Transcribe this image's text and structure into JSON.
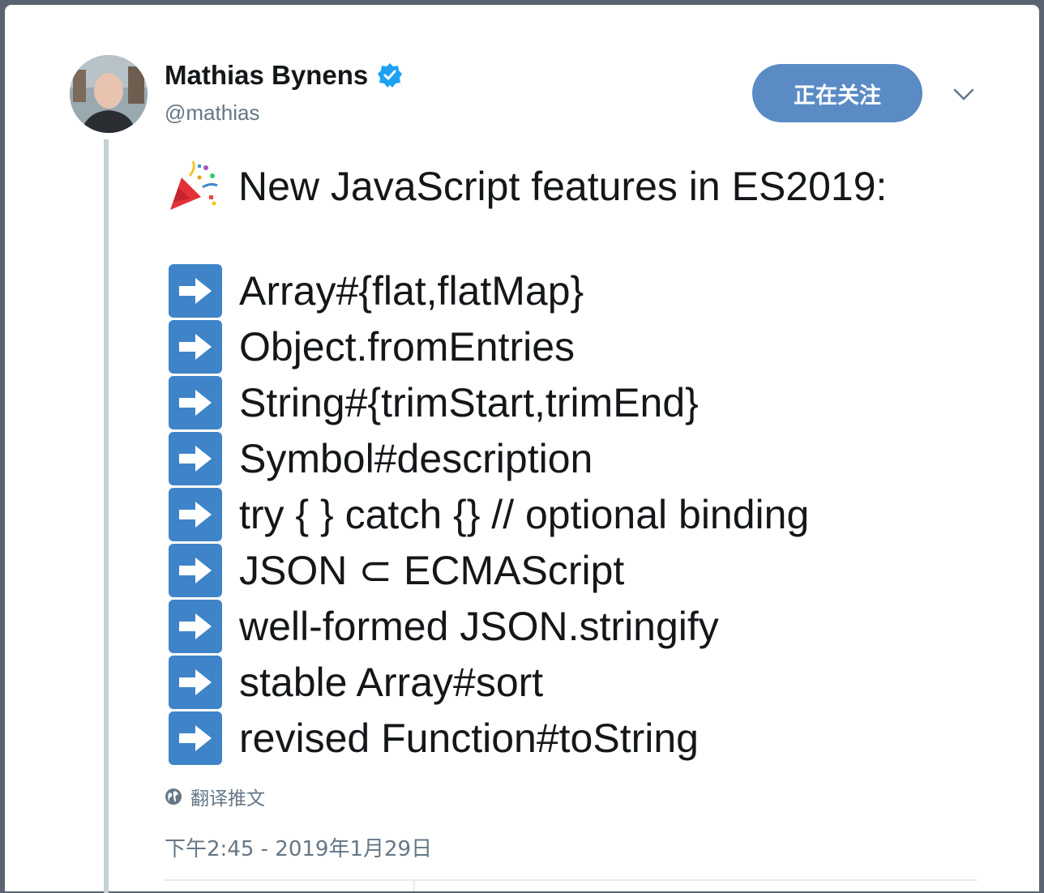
{
  "author": {
    "display_name": "Mathias Bynens",
    "handle": "@mathias",
    "verified": true
  },
  "follow_button": {
    "label": "正在关注"
  },
  "tweet": {
    "headline_emoji": "party-popper-icon",
    "headline": "New JavaScript features in ES2019:",
    "bullet_icon": "right-arrow-icon",
    "features": [
      "Array#{flat,flatMap}",
      "Object.fromEntries",
      "String#{trimStart,trimEnd}",
      "Symbol#description",
      "try { } catch {} // optional binding",
      "JSON ⊂ ECMAScript",
      "well-formed JSON.stringify",
      "stable Array#sort",
      "revised Function#toString"
    ]
  },
  "translate_label": "翻译推文",
  "timestamp": "下午2:45 - 2019年1月29日",
  "colors": {
    "follow_button": "#5b8bc5",
    "arrow_bullet": "#3f84c9",
    "verified_badge": "#1da1f2",
    "secondary_text": "#657786"
  }
}
